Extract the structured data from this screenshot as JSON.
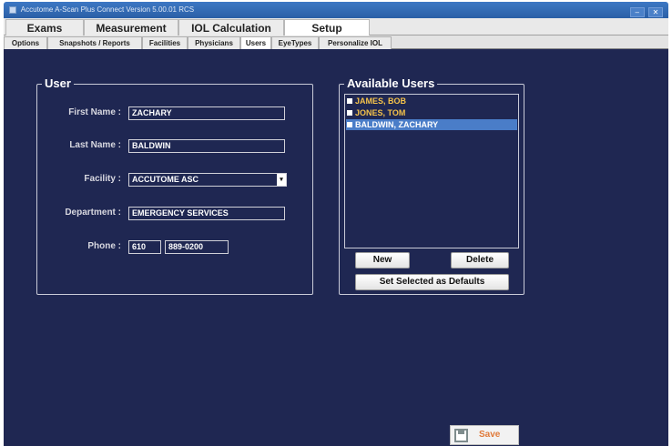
{
  "window": {
    "title": "Accutome A-Scan Plus Connect Version 5.00.01 RCS",
    "minimize": "–",
    "close": "✕"
  },
  "main_tabs": [
    {
      "label": "Exams"
    },
    {
      "label": "Measurement"
    },
    {
      "label": "IOL Calculation"
    },
    {
      "label": "Setup"
    }
  ],
  "sub_tabs": [
    {
      "label": "Options"
    },
    {
      "label": "Snapshots / Reports"
    },
    {
      "label": "Facilities"
    },
    {
      "label": "Physicians"
    },
    {
      "label": "Users"
    },
    {
      "label": "EyeTypes"
    },
    {
      "label": "Personalize IOL"
    }
  ],
  "user_form": {
    "legend": "User",
    "first_name_label": "First Name :",
    "first_name": "ZACHARY",
    "last_name_label": "Last Name :",
    "last_name": "BALDWIN",
    "facility_label": "Facility :",
    "facility": "ACCUTOME ASC",
    "department_label": "Department :",
    "department": "EMERGENCY SERVICES",
    "phone_label": "Phone :",
    "phone_area": "610",
    "phone_number": "889-0200"
  },
  "available_users": {
    "legend": "Available Users",
    "users": [
      {
        "name": "JAMES, BOB",
        "selected": false
      },
      {
        "name": "JONES, TOM",
        "selected": false
      },
      {
        "name": "BALDWIN, ZACHARY",
        "selected": true
      }
    ],
    "new_label": "New",
    "delete_label": "Delete",
    "defaults_label": "Set Selected as Defaults"
  },
  "footer": {
    "save_label": "Save"
  },
  "colors": {
    "background": "#1f2752",
    "user_name": "#f4c24a",
    "selection": "#4a7dc8",
    "save_text": "#e07a3a"
  }
}
